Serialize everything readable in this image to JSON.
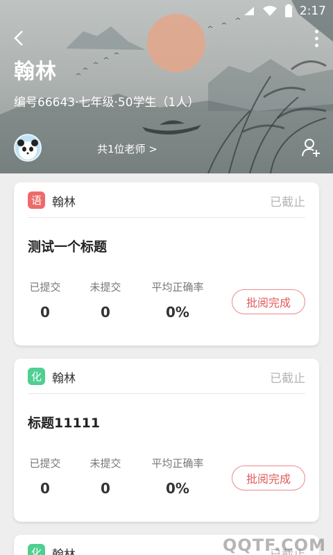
{
  "status_bar": {
    "time": "2:17"
  },
  "header": {
    "class_title": "翰林",
    "class_info": "编号66643·七年级·50学生（1人）",
    "teachers_link": "共1位老师 >"
  },
  "cards": [
    {
      "subject_char": "语",
      "subject_color": "#ee6b6b",
      "teacher": "翰林",
      "status": "已截止",
      "title": "测试一个标题",
      "stats": [
        {
          "label": "已提交",
          "value": "0"
        },
        {
          "label": "未提交",
          "value": "0"
        },
        {
          "label": "平均正确率",
          "value": "0%"
        }
      ],
      "action": "批阅完成"
    },
    {
      "subject_char": "化",
      "subject_color": "#4fcf92",
      "teacher": "翰林",
      "status": "已截止",
      "title": "标题11111",
      "stats": [
        {
          "label": "已提交",
          "value": "0"
        },
        {
          "label": "未提交",
          "value": "0"
        },
        {
          "label": "平均正确率",
          "value": "0%"
        }
      ],
      "action": "批阅完成"
    },
    {
      "subject_char": "化",
      "subject_color": "#4fcf92",
      "teacher": "翰林",
      "status": "已截止"
    }
  ],
  "watermark": "QQTF.COM",
  "icons": {
    "back": "back-arrow-icon",
    "more": "more-vertical-icon",
    "add_user": "add-user-icon",
    "wifi": "wifi-icon",
    "battery": "battery-icon",
    "signal": "signal-icon"
  }
}
